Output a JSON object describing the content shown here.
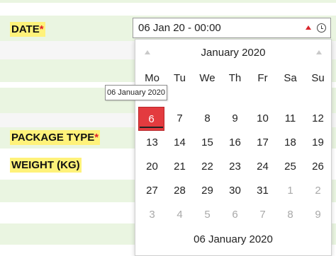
{
  "form": {
    "date_label": "DATE",
    "package_type_label": "PACKAGE TYPE",
    "weight_label": "WEIGHT (KG)",
    "required_marker": "*"
  },
  "date_input": {
    "value": "06 Jan 20 - 00:00",
    "icons": [
      "triangle-up-icon",
      "clock-icon"
    ]
  },
  "calendar": {
    "title": "January 2020",
    "weekdays": [
      "Mo",
      "Tu",
      "We",
      "Th",
      "Fr",
      "Sa",
      "Su"
    ],
    "days": [
      "6",
      "7",
      "8",
      "9",
      "10",
      "11",
      "12",
      "13",
      "14",
      "15",
      "16",
      "17",
      "18",
      "19",
      "20",
      "21",
      "22",
      "23",
      "24",
      "25",
      "26",
      "27",
      "28",
      "29",
      "30",
      "31",
      "1",
      "2",
      "3",
      "4",
      "5",
      "6",
      "7",
      "8",
      "9"
    ],
    "selected_index": 0,
    "other_month_from_index": 26,
    "footer": "06 January 2020",
    "tooltip": "06 January 2020"
  },
  "colors": {
    "selected_day": "#e33b3f",
    "label_highlight": "#fff27a",
    "required": "#e0202a",
    "row_green": "#eaf5e1"
  }
}
